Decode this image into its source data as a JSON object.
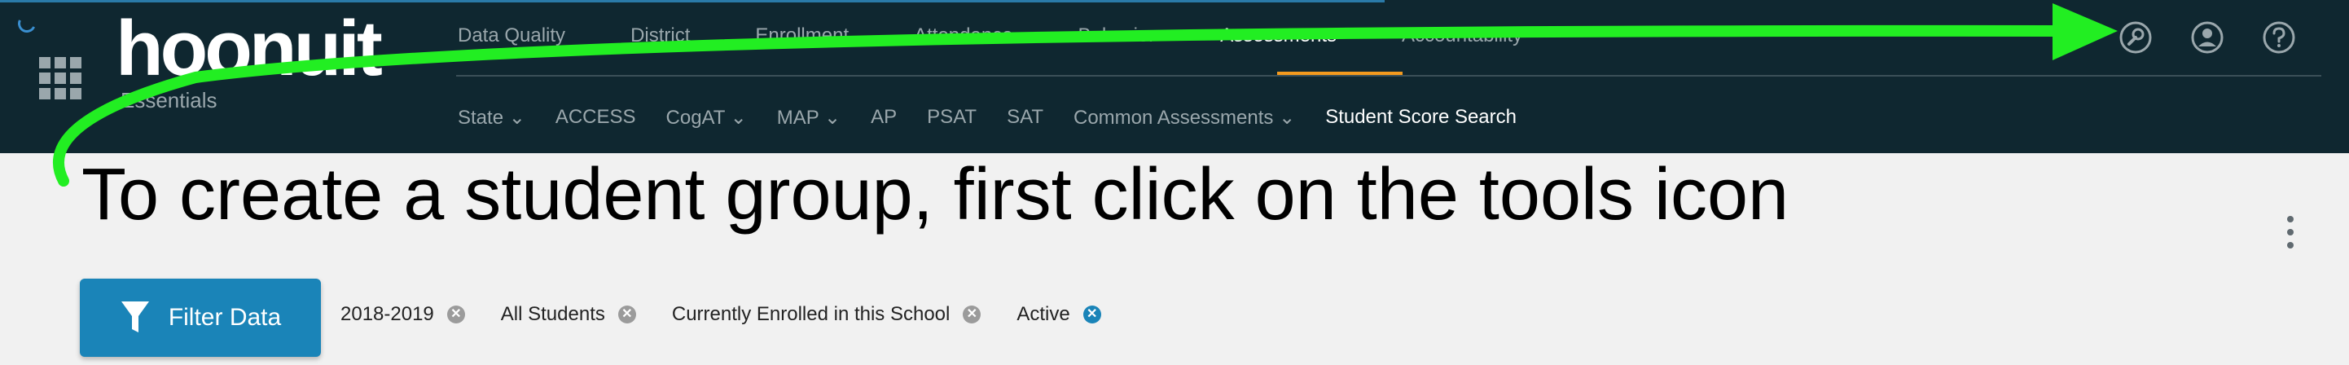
{
  "app": {
    "logo_text": "hoonuit",
    "logo_subtitle": "Essentials"
  },
  "nav": {
    "tabs": [
      {
        "label": "Data Quality"
      },
      {
        "label": "District"
      },
      {
        "label": "Enrollment"
      },
      {
        "label": "Attendance"
      },
      {
        "label": "Behavior"
      },
      {
        "label": "Assessments",
        "active": true
      },
      {
        "label": "Accountability"
      }
    ]
  },
  "subnav": {
    "items": [
      {
        "label": "State ⌄"
      },
      {
        "label": "ACCESS"
      },
      {
        "label": "CogAT ⌄"
      },
      {
        "label": "MAP ⌄"
      },
      {
        "label": "AP"
      },
      {
        "label": "PSAT"
      },
      {
        "label": "SAT"
      },
      {
        "label": "Common Assessments ⌄"
      },
      {
        "label": "Student Score Search",
        "active": true
      }
    ]
  },
  "header_icons": [
    "tools-icon",
    "user-icon",
    "help-icon"
  ],
  "annotation": {
    "text": "To create a student group, first click on the tools icon"
  },
  "filter": {
    "button_label": "Filter Data",
    "chips": [
      {
        "label": "2018-2019"
      },
      {
        "label": "All Students"
      },
      {
        "label": "Currently Enrolled in this School"
      },
      {
        "label": "Active",
        "active": true
      }
    ],
    "remove_glyph": "✕"
  },
  "colors": {
    "header_bg": "#0f2730",
    "accent": "#f39a1e",
    "primary": "#1a84b8",
    "annotation_arrow": "#22ee22"
  }
}
